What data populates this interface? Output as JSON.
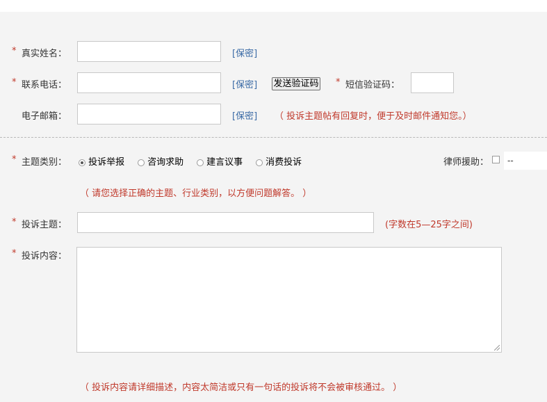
{
  "contact": {
    "name_label": "真实姓名：",
    "phone_label": "联系电话：",
    "email_label": "电子邮箱：",
    "secret_label": "[保密]",
    "send_code_button": "发送验证码",
    "sms_code_label": "短信验证码：",
    "email_hint": "（ 投诉主题帖有回复时，便于及时邮件通知您。）",
    "required_mark": "*"
  },
  "category": {
    "label": "主题类别：",
    "options": [
      "投诉举报",
      "咨询求助",
      "建言议事",
      "消费投诉"
    ],
    "selected_index": 0,
    "hint": "（ 请您选择正确的主题、行业类别，以方便问题解答。 ）",
    "lawyer_label": "律师援助：",
    "lawyer_select_value": "--"
  },
  "complaint": {
    "subject_label": "投诉主题：",
    "subject_hint": "(字数在5—25字之间)",
    "content_label": "投诉内容：",
    "content_hint": "（ 投诉内容请详细描述，内容太简洁或只有一句话的投诉将不会被审核通过。 ）"
  },
  "colors": {
    "required": "#c0392b",
    "link": "#3a6aa5",
    "background": "#f4f4f4"
  }
}
